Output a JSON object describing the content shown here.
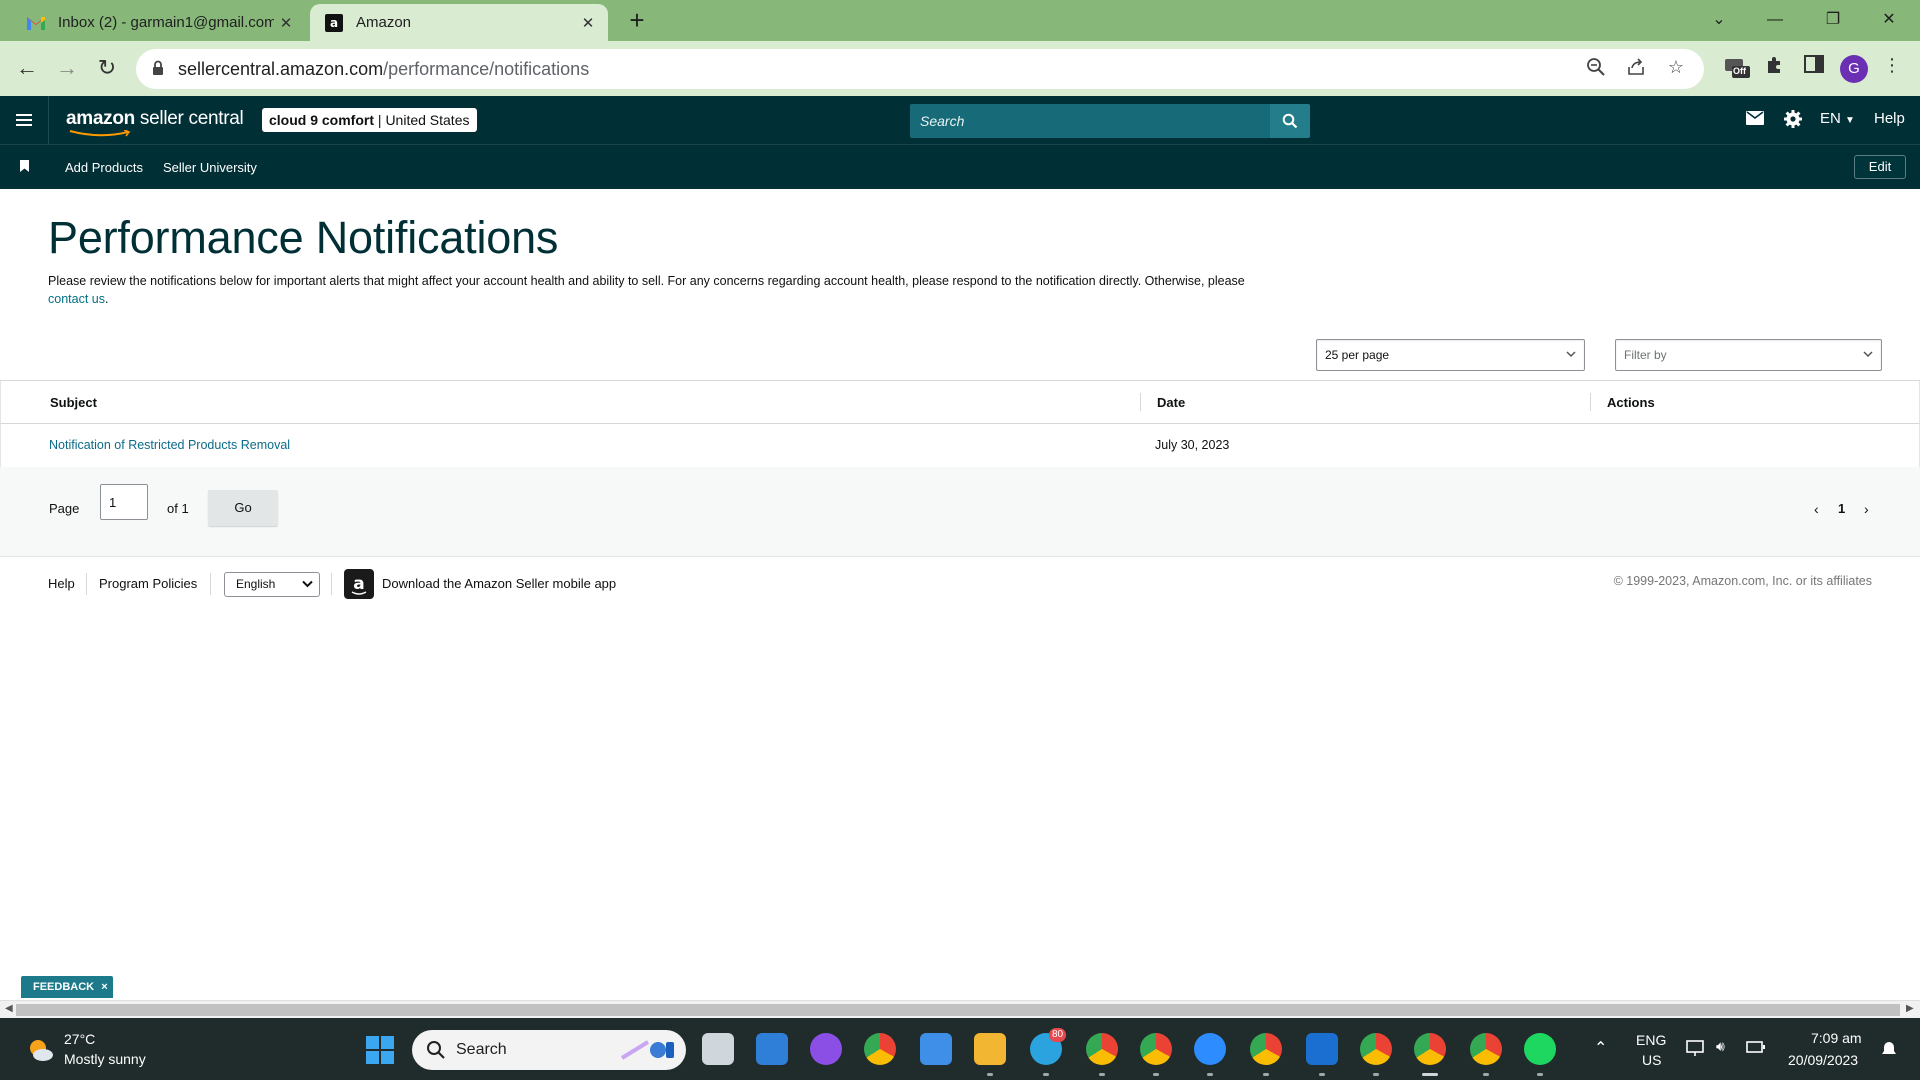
{
  "browser": {
    "tabs": [
      {
        "title": "Inbox (2) - garmain1@gmail.com"
      },
      {
        "title": "Amazon"
      }
    ],
    "url_host": "sellercentral.amazon.com",
    "url_path": "/performance/notifications",
    "profile_initial": "G",
    "extension_badge": "Off"
  },
  "header": {
    "brand_main": "amazon",
    "brand_sub": " seller central",
    "store_name": "cloud 9 comfort",
    "store_sep": " | ",
    "store_region": "United States",
    "search_placeholder": "Search",
    "language": "EN",
    "help": "Help"
  },
  "subnav": {
    "links": [
      "Add Products",
      "Seller University"
    ],
    "edit": "Edit"
  },
  "page": {
    "title": "Performance Notifications",
    "intro_text": "Please review the notifications below for important alerts that might affect your account health and ability to sell. For any concerns regarding account health, please respond to the notification directly. Otherwise, please ",
    "intro_link": "contact us",
    "intro_end": ".",
    "per_page": "25 per page",
    "filter_placeholder": "Filter by"
  },
  "table": {
    "columns": [
      "Subject",
      "Date",
      "Actions"
    ],
    "rows": [
      {
        "subject": "Notification of Restricted Products Removal",
        "date": "July 30, 2023",
        "actions": ""
      }
    ]
  },
  "pagination": {
    "page_label": "Page",
    "current": "1",
    "of_label": "of 1",
    "go": "Go",
    "page_number": "1"
  },
  "footer": {
    "help": "Help",
    "program_policies": "Program Policies",
    "language": "English",
    "download_app": "Download the Amazon Seller mobile app",
    "copyright": "© 1999-2023, Amazon.com, Inc. or its affiliates"
  },
  "feedback": {
    "label": "FEEDBACK",
    "close": "×"
  },
  "taskbar": {
    "temp": "27°C",
    "weather": "Mostly sunny",
    "search": "Search",
    "telegram_badge": "80",
    "lang_line1": "ENG",
    "lang_line2": "US",
    "time": "7:09 am",
    "date": "20/09/2023"
  },
  "colors": {
    "tabbar": "#87b87a",
    "toolbar": "#d9ecd2",
    "header": "#002f36",
    "search": "#176a77",
    "link": "#007185",
    "taskbar": "#202b2b"
  }
}
